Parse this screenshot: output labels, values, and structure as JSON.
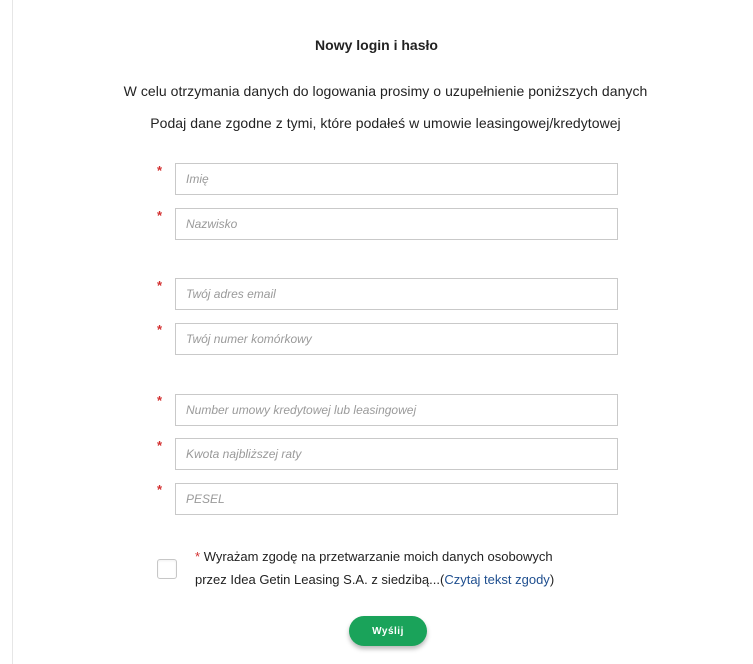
{
  "form": {
    "title": "Nowy login i hasło",
    "intro_line1": "W celu otrzymania danych do logowania prosimy o uzupełnienie poniższych danych",
    "intro_line2": "Podaj dane zgodne z tymi, które podałeś w umowie leasingowej/kredytowej",
    "required_marker": "*",
    "fields": {
      "first_name": {
        "placeholder": "Imię",
        "value": ""
      },
      "last_name": {
        "placeholder": "Nazwisko",
        "value": ""
      },
      "email": {
        "placeholder": "Twój adres email",
        "value": ""
      },
      "phone": {
        "placeholder": "Twój numer komórkowy",
        "value": ""
      },
      "contract_number": {
        "placeholder": "Number umowy kredytowej lub leasingowej",
        "value": ""
      },
      "next_installment": {
        "placeholder": "Kwota najbliższej raty",
        "value": ""
      },
      "pesel": {
        "placeholder": "PESEL",
        "value": ""
      }
    },
    "consent": {
      "checked": false,
      "text_line1": "Wyrażam zgodę na przetwarzanie moich danych osobowych",
      "text_line2_prefix": "przez Idea Getin Leasing S.A. z siedzibą...(",
      "link_text": "Czytaj tekst zgody",
      "text_line2_suffix": ")"
    },
    "submit_label": "Wyślij"
  },
  "colors": {
    "required": "#d32f2f",
    "submit_bg": "#1aa35a",
    "link": "#1f4f8f",
    "field_border": "#c9c9c9"
  }
}
